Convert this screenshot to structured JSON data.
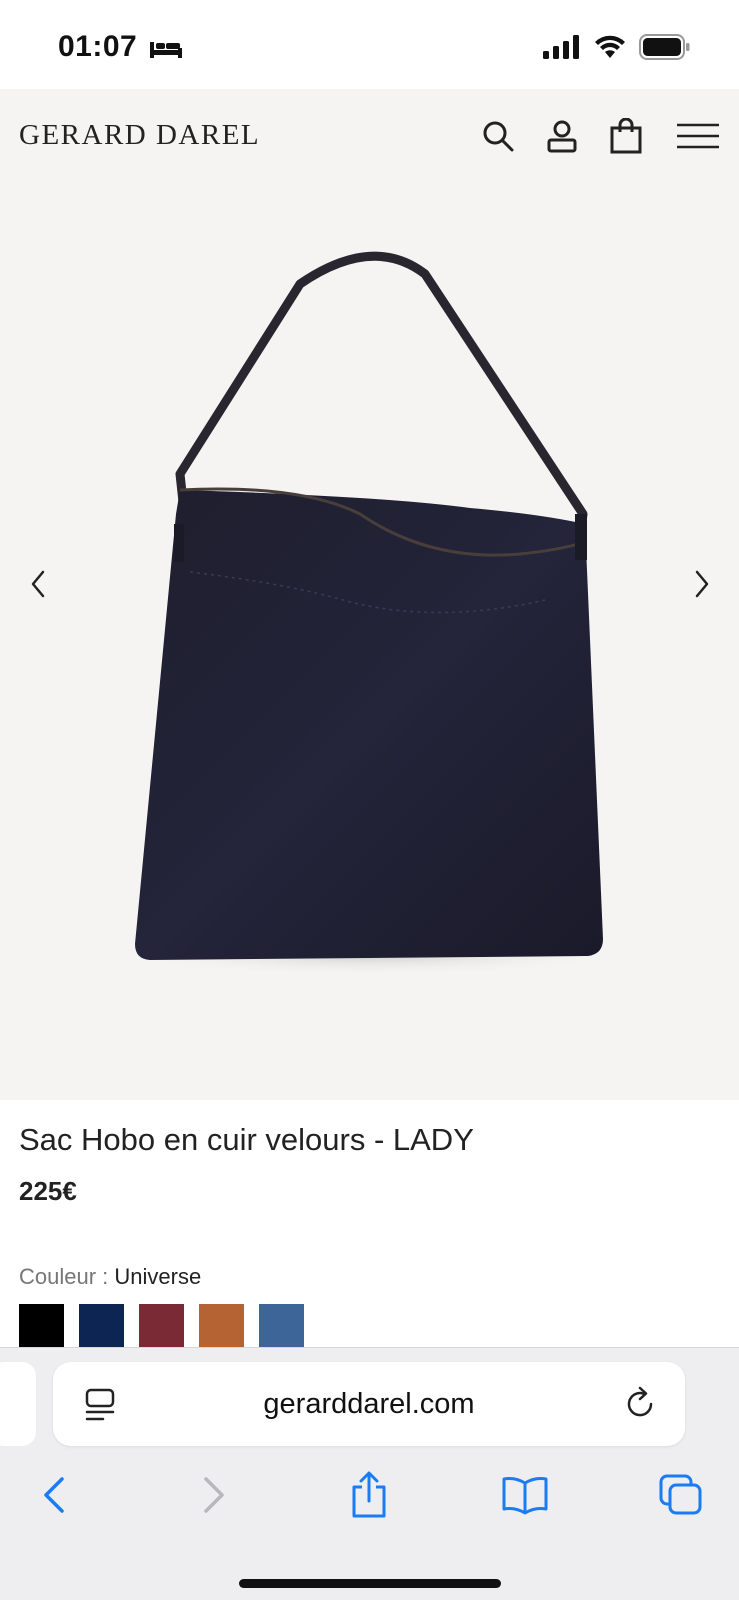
{
  "status": {
    "time": "01:07",
    "sleep_icon": "bed-icon",
    "signal_icon": "cellular-signal-icon",
    "wifi_icon": "wifi-icon",
    "battery_icon": "battery-icon"
  },
  "header": {
    "logo": "GERARD DAREL",
    "icons": [
      "search-icon",
      "account-icon",
      "shopping-bag-icon",
      "menu-icon"
    ]
  },
  "gallery": {
    "prev_icon": "chevron-left-icon",
    "next_icon": "chevron-right-icon"
  },
  "product": {
    "title": "Sac Hobo en cuir velours - LADY",
    "price": "225€",
    "color_label": "Couleur :",
    "color_value": "Universe",
    "swatches": [
      "#000000",
      "#0d2553",
      "#7a2a34",
      "#b56333",
      "#3d6597"
    ]
  },
  "browser": {
    "url": "gerarddarel.com",
    "accent": "#1a7cf5",
    "toolbar": [
      "back-icon",
      "forward-icon",
      "share-icon",
      "bookmarks-icon",
      "tabs-icon"
    ]
  }
}
